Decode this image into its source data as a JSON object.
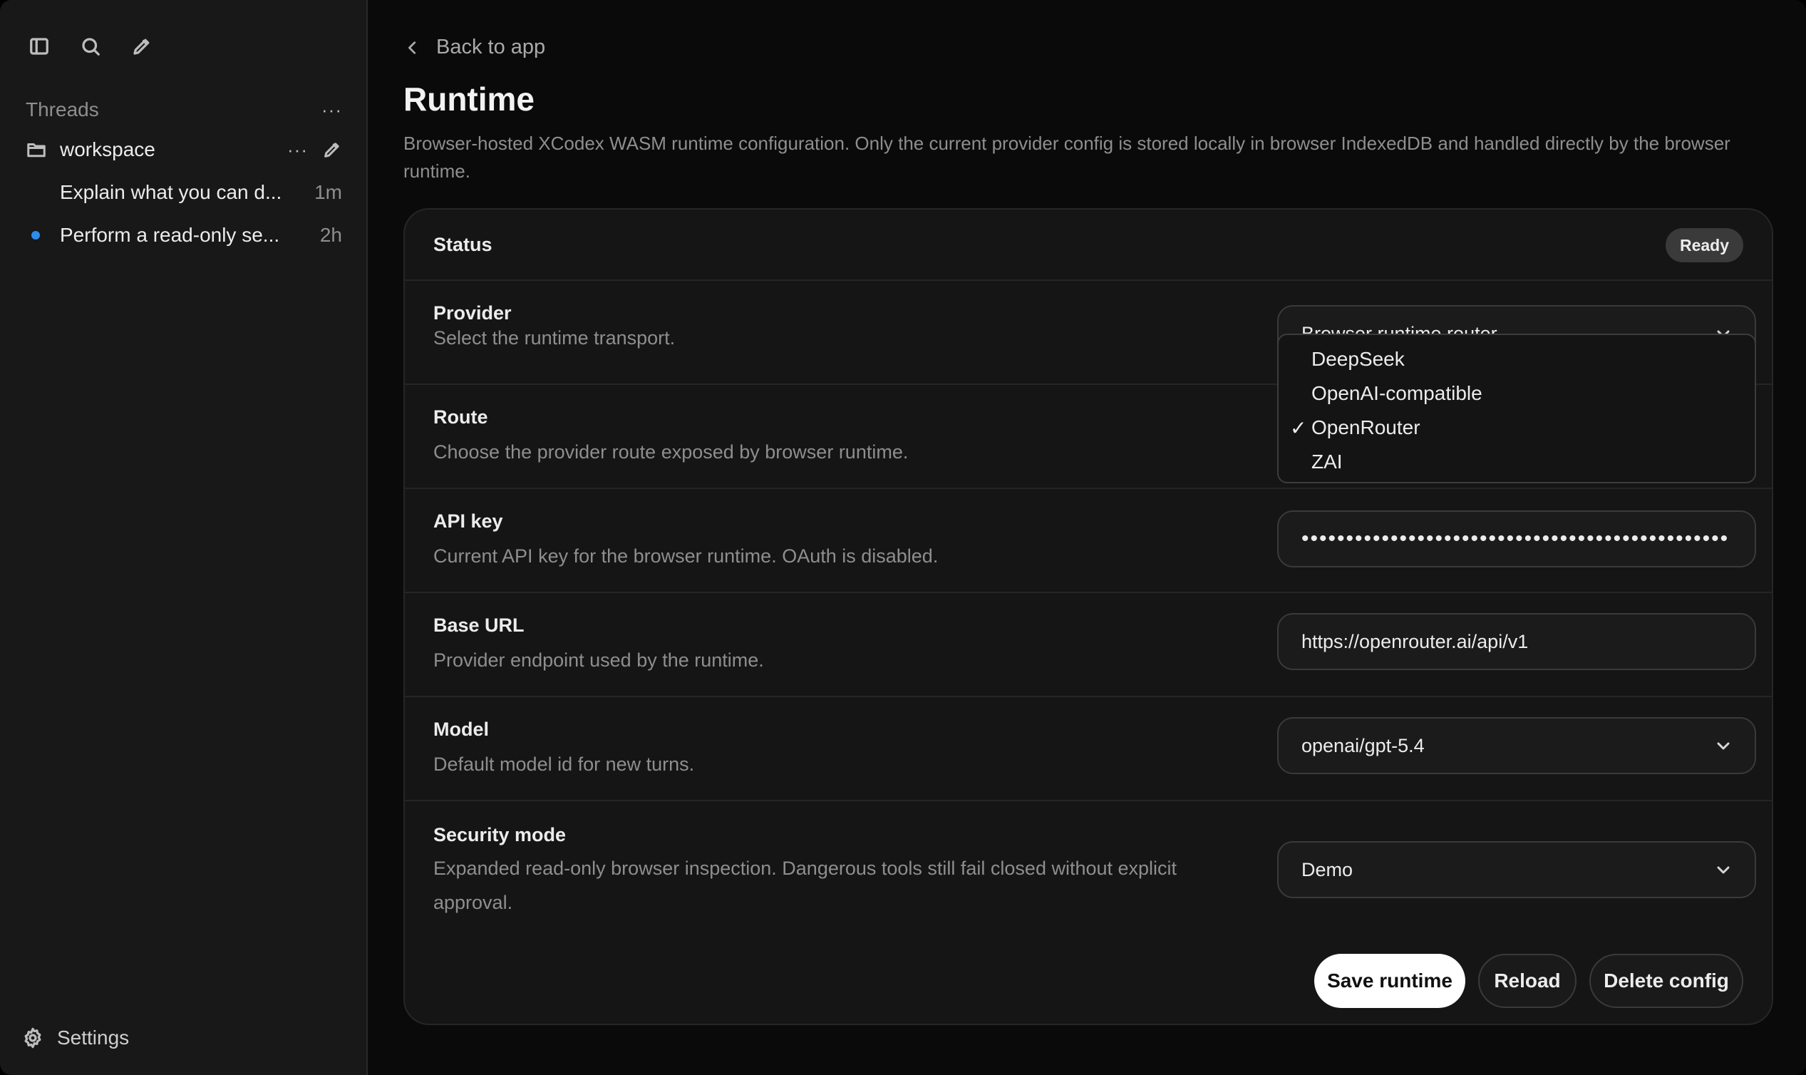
{
  "sidebar": {
    "threads_label": "Threads",
    "more_label": "···",
    "workspace": {
      "name": "workspace",
      "more_label": "···"
    },
    "threads": [
      {
        "title": "Explain what you can d...",
        "time": "1m",
        "unread": false
      },
      {
        "title": "Perform a read-only se...",
        "time": "2h",
        "unread": true
      }
    ],
    "settings_label": "Settings"
  },
  "header": {
    "back_label": "Back to app",
    "title": "Runtime",
    "description": "Browser-hosted XCodex WASM runtime configuration. Only the current provider config is stored locally in browser IndexedDB and handled directly by the browser runtime."
  },
  "status": {
    "label": "Status",
    "badge": "Ready"
  },
  "provider": {
    "label": "Provider",
    "description": "Select the runtime transport.",
    "value": "Browser runtime router"
  },
  "route": {
    "label": "Route",
    "description": "Choose the provider route exposed by browser runtime.",
    "options": [
      "DeepSeek",
      "OpenAI-compatible",
      "OpenRouter",
      "ZAI"
    ],
    "selected": "OpenRouter",
    "check_mark": "✓"
  },
  "api_key": {
    "label": "API key",
    "description": "Current API key for the browser runtime. OAuth is disabled.",
    "masked_value": "••••••••••••••••••••••••••••••••••••••••••••••••"
  },
  "base_url": {
    "label": "Base URL",
    "description": "Provider endpoint used by the runtime.",
    "value": "https://openrouter.ai/api/v1"
  },
  "model": {
    "label": "Model",
    "description": "Default model id for new turns.",
    "value": "openai/gpt-5.4"
  },
  "security": {
    "label": "Security mode",
    "description": "Expanded read-only browser inspection. Dangerous tools still fail closed without explicit approval.",
    "value": "Demo"
  },
  "actions": {
    "save_label": "Save runtime",
    "reload_label": "Reload",
    "delete_label": "Delete config"
  },
  "icons": [
    "sidebar-toggle-icon",
    "search-icon",
    "new-thread-icon",
    "folder-icon",
    "pencil-icon",
    "gear-icon",
    "chevron-left-icon",
    "chevron-down-icon"
  ],
  "colors": {
    "unread_dot": "#2d8cf0",
    "primary_button": "#ffffff"
  }
}
